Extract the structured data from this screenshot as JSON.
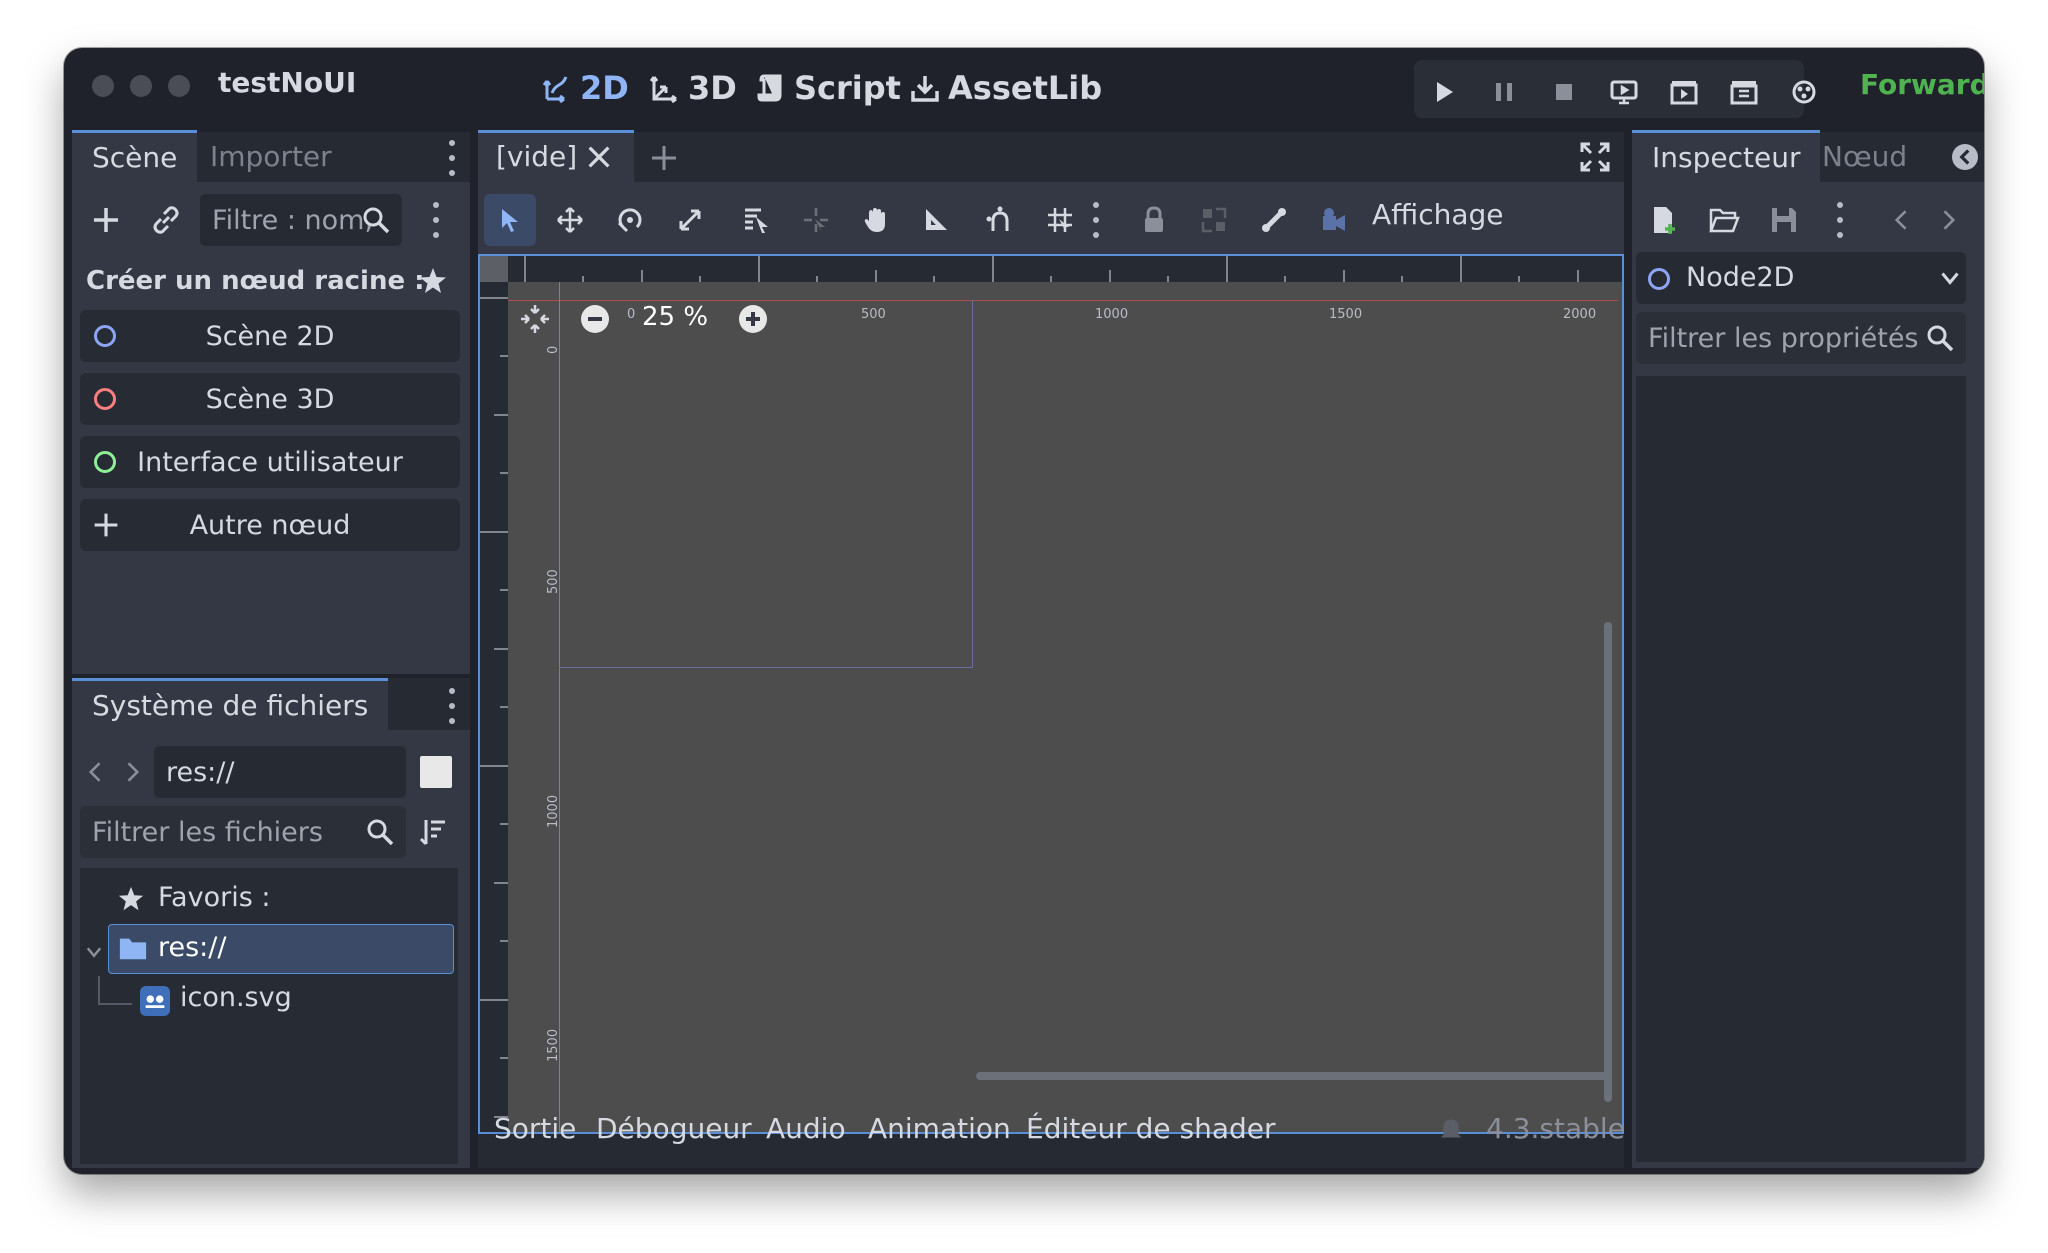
{
  "titlebar": {
    "project_name": "testNoUI",
    "main_tabs": [
      "2D",
      "3D",
      "Script",
      "AssetLib"
    ],
    "renderer": "Forward+"
  },
  "scene_dock": {
    "tabs": [
      "Scène",
      "Importer"
    ],
    "filter_placeholder": "Filtre : nom,",
    "create_root_label": "Créer un nœud racine :",
    "create_items": [
      "Scène 2D",
      "Scène 3D",
      "Interface utilisateur",
      "Autre nœud"
    ]
  },
  "filesystem_dock": {
    "tab": "Système de fichiers",
    "path": "res://",
    "filter_placeholder": "Filtrer les fichiers",
    "favorites_label": "Favoris :",
    "tree": [
      {
        "name": "res://",
        "type": "folder",
        "selected": true
      },
      {
        "name": "icon.svg",
        "type": "file"
      }
    ]
  },
  "editor": {
    "scene_tab": "[vide]",
    "view_menu": "Affichage",
    "zoom": "25 %",
    "ruler_h": [
      "0",
      "500",
      "1000",
      "1500",
      "2000"
    ],
    "ruler_v": [
      "0",
      "500",
      "1000",
      "1500"
    ]
  },
  "bottom_panel": {
    "tabs": [
      "Sortie",
      "Débogueur",
      "Audio",
      "Animation",
      "Éditeur de shader"
    ],
    "version": "4.3.stable"
  },
  "inspector": {
    "tabs": [
      "Inspecteur",
      "Nœud"
    ],
    "node_type": "Node2D",
    "filter_placeholder": "Filtrer les propriétés"
  },
  "colors": {
    "accent": "#8fb5f5",
    "renderer": "#4fb34f",
    "node2d": "#8da5f3",
    "node3d": "#fc7f7f",
    "control": "#8eef97",
    "viewport_bg": "#4d4d4d",
    "selection": "#2c3e5c"
  },
  "icons": [
    "script-icon",
    "assetlib-icon",
    "play-icon",
    "pause-icon",
    "stop-icon",
    "remote-debug-icon",
    "movie-icon",
    "clapper-icon",
    "bug-icon"
  ]
}
